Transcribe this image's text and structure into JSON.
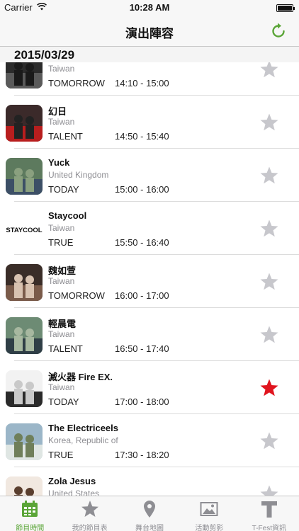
{
  "status_bar": {
    "carrier": "Carrier",
    "time": "10:28 AM"
  },
  "nav": {
    "title": "演出陣容"
  },
  "section": {
    "date": "2015/03/29"
  },
  "artists": [
    {
      "name": "",
      "country": "Taiwan",
      "stage": "TOMORROW",
      "time": "14:10 - 15:00",
      "favorite": false
    },
    {
      "name": "幻日",
      "country": "Taiwan",
      "stage": "TALENT",
      "time": "14:50 - 15:40",
      "favorite": false
    },
    {
      "name": "Yuck",
      "country": "United Kingdom",
      "stage": "TODAY",
      "time": "15:00 - 16:00",
      "favorite": false
    },
    {
      "name": "Staycool",
      "country": "Taiwan",
      "stage": "TRUE",
      "time": "15:50 - 16:40",
      "favorite": false,
      "logo": "STAYCOOL"
    },
    {
      "name": "魏如萱",
      "country": "Taiwan",
      "stage": "TOMORROW",
      "time": "16:00 - 17:00",
      "favorite": false
    },
    {
      "name": "輕晨電",
      "country": "Taiwan",
      "stage": "TALENT",
      "time": "16:50 - 17:40",
      "favorite": false
    },
    {
      "name": "滅火器 Fire EX.",
      "country": "Taiwan",
      "stage": "TODAY",
      "time": "17:00 - 18:00",
      "favorite": true
    },
    {
      "name": "The Electriceels",
      "country": "Korea, Republic of",
      "stage": "TRUE",
      "time": "17:30 - 18:20",
      "favorite": false
    },
    {
      "name": "Zola Jesus",
      "country": "United States",
      "stage": "",
      "time": "",
      "favorite": false
    }
  ],
  "tabs": [
    {
      "label": "節目時間",
      "icon": "calendar-icon",
      "active": true
    },
    {
      "label": "我的節目表",
      "icon": "star-icon",
      "active": false
    },
    {
      "label": "舞台地圖",
      "icon": "map-pin-icon",
      "active": false
    },
    {
      "label": "活動剪影",
      "icon": "photo-icon",
      "active": false
    },
    {
      "label": "T-Fest資訊",
      "icon": "t-logo-icon",
      "active": false
    }
  ],
  "colors": {
    "accent_green": "#5aa537",
    "favorite_red": "#e0141e",
    "star_gray": "#c7c7cc"
  }
}
